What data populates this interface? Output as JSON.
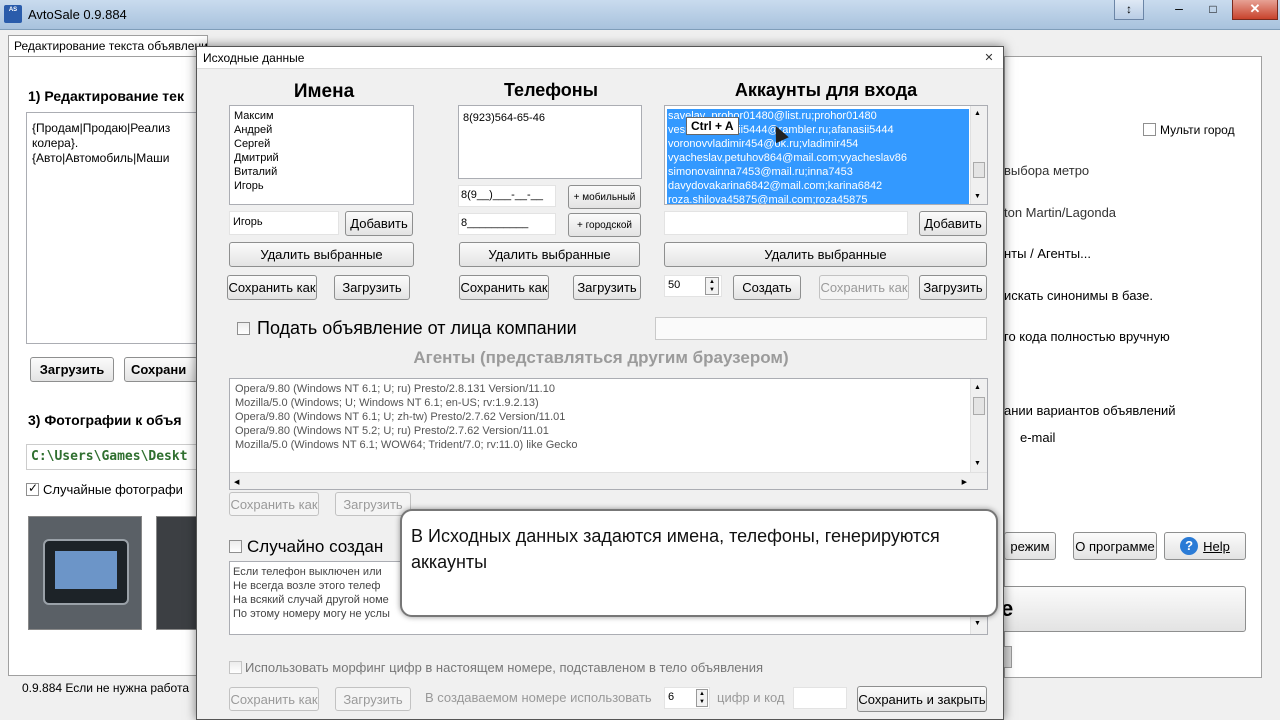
{
  "app": {
    "title": "AvtoSale 0.9.884",
    "logo_text": "Avto\nSale"
  },
  "main": {
    "group_label": "Редактирование текста объявлени",
    "section1": "1) Редактирование тек",
    "text_lines": [
      "{Продам|Продаю|Реализ",
      "колера}.",
      "{Авто|Автомобиль|Маши"
    ],
    "load_btn": "Загрузить",
    "save_btn": "Сохрани",
    "section3": "3) Фотографии к объя",
    "photos_path": "C:\\Users\\Games\\Deskt",
    "random_photos": "Случайные фотографи",
    "status": "0.9.884 Если не нужна работа",
    "multi_city": "Мульти город",
    "right_lines": [
      "выбора метро",
      "ton Martin/Lagonda",
      "нты / Агенты...",
      "искать синонимы в базе.",
      "го кода полностью вручную",
      "ании вариантов объявлений",
      "e-mail"
    ],
    "mode_btn": "режим",
    "about_btn": "О программе",
    "help_btn": "Help",
    "big_btn": "е"
  },
  "dialog": {
    "title": "Исходные данные",
    "names_header": "Имена",
    "phones_header": "Телефоны",
    "accounts_header": "Аккаунты для входа",
    "names": [
      "Максим",
      "Андрей",
      "Сергей",
      "Дмитрий",
      "Виталий",
      "Игорь"
    ],
    "name_input": "Игорь",
    "add": "Добавить",
    "delete_selected": "Удалить выбранные",
    "save_as": "Сохранить как",
    "load": "Загрузить",
    "create": "Создать",
    "phones": [
      "8(923)564-65-46"
    ],
    "mobile_mask": "8(9__)___-__-__",
    "mobile_btn": "+ мобильный",
    "city_mask": "8__________",
    "city_btn": "+ городской",
    "accounts": [
      "savelav_prohor01480@list.ru;prohor01480",
      "vesnov.afanasii5444@rambler.ru;afanasii5444",
      "voronovvladimir454@ok.ru;vladimir454",
      "vyacheslav.petuhov864@mail.com;vyacheslav86",
      "simonovainna7453@mail.ru;inna7453",
      "davydovakarina6842@mail.com;karina6842",
      "roza.shilova45875@mail.com;roza45875"
    ],
    "account_count": "50",
    "ctrl_hint": "Ctrl + A",
    "company_label": "Подать объявление от лица компании",
    "agents_header": "Агенты (представляться другим браузером)",
    "agents": [
      "Opera/9.80 (Windows NT 6.1; U; ru) Presto/2.8.131 Version/11.10",
      "Mozilla/5.0 (Windows; U; Windows NT 6.1; en-US; rv:1.9.2.13)",
      "Opera/9.80 (Windows NT 6.1; U; zh-tw) Presto/2.7.62 Version/11.01",
      "Opera/9.80 (Windows NT 5.2; U; ru) Presto/2.7.62 Version/11.01",
      "Mozilla/5.0 (Windows NT 6.1; WOW64; Trident/7.0; rv:11.0) like Gecko"
    ],
    "random_created": "Случайно создан",
    "phone_notes": [
      "Если телефон выключен или",
      "Не всегда возле этого телеф",
      "На всякий случай другой номе",
      "По этому номеру могу не услы"
    ],
    "morph_label": "Использовать морфинг цифр в настоящем номере, подставленом в тело объявления",
    "in_created": "В создаваемом номере использовать",
    "digits_value": "6",
    "digits_and_code": "цифр и код",
    "save_close": "Сохранить и закрыть"
  },
  "tooltip": "В Исходных данных задаются имена, телефоны, генерируются аккаунты"
}
